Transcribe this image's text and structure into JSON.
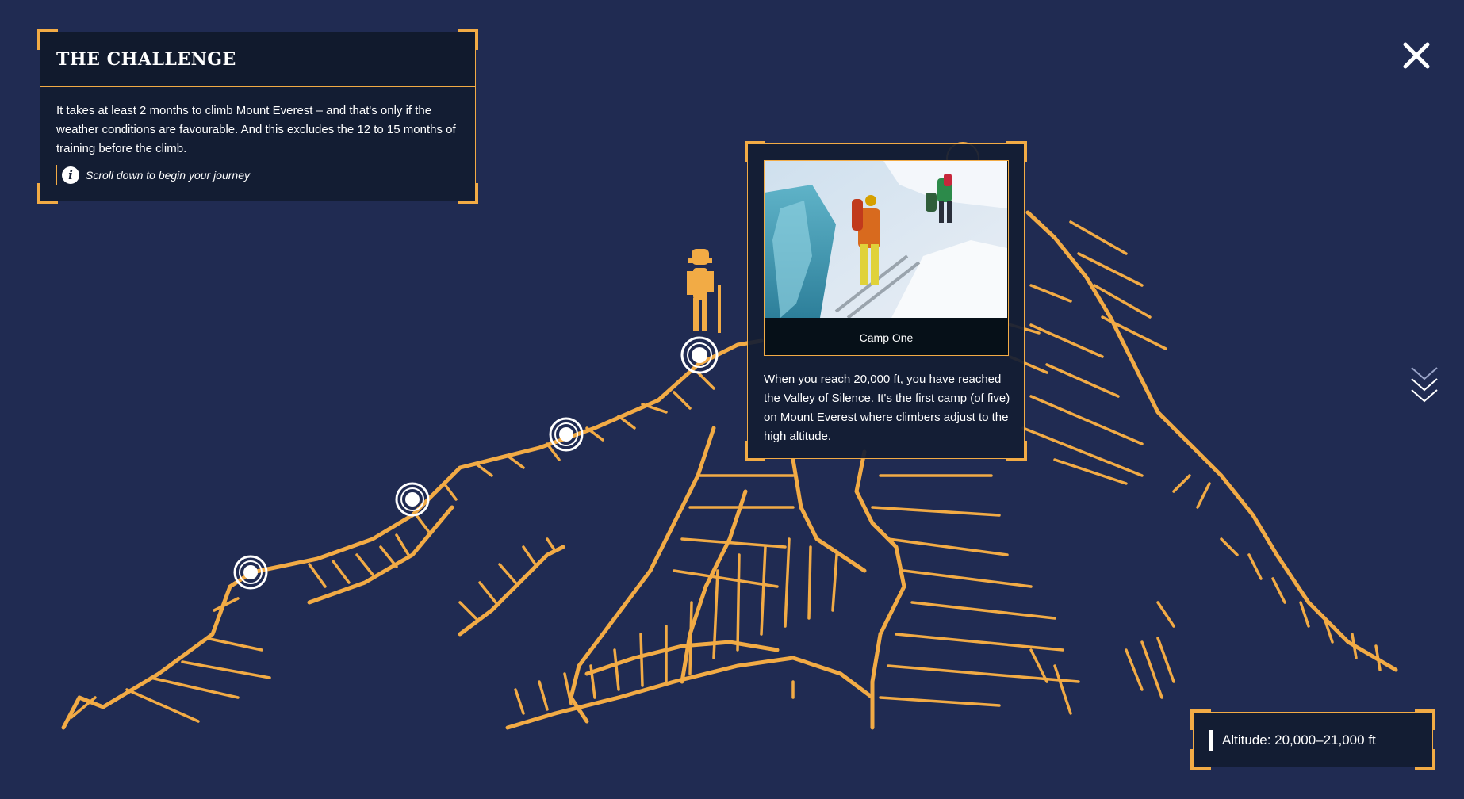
{
  "intro": {
    "title": "THE CHALLENGE",
    "body": "It takes at least 2 months to climb Mount Everest – and that's only if the weather conditions are favourable. And this excludes the 12 to 15 months of training before the climb.",
    "hint": "Scroll down to begin your journey",
    "hint_icon": "info-icon"
  },
  "camp": {
    "caption": "Camp One",
    "description": "When you reach 20,000 ft, you have reached the Valley of Silence. It's the first camp (of five) on Mount Everest where climbers adjust to the high altitude."
  },
  "altitude": {
    "label": "Altitude: 20,000–21,000 ft"
  },
  "controls": {
    "close_icon": "close-icon",
    "scroll_icon": "chevron-down-icon"
  },
  "colors": {
    "background": "#202b52",
    "accent": "#f2ab45",
    "panel": "#131d33",
    "text": "#ffffff"
  }
}
